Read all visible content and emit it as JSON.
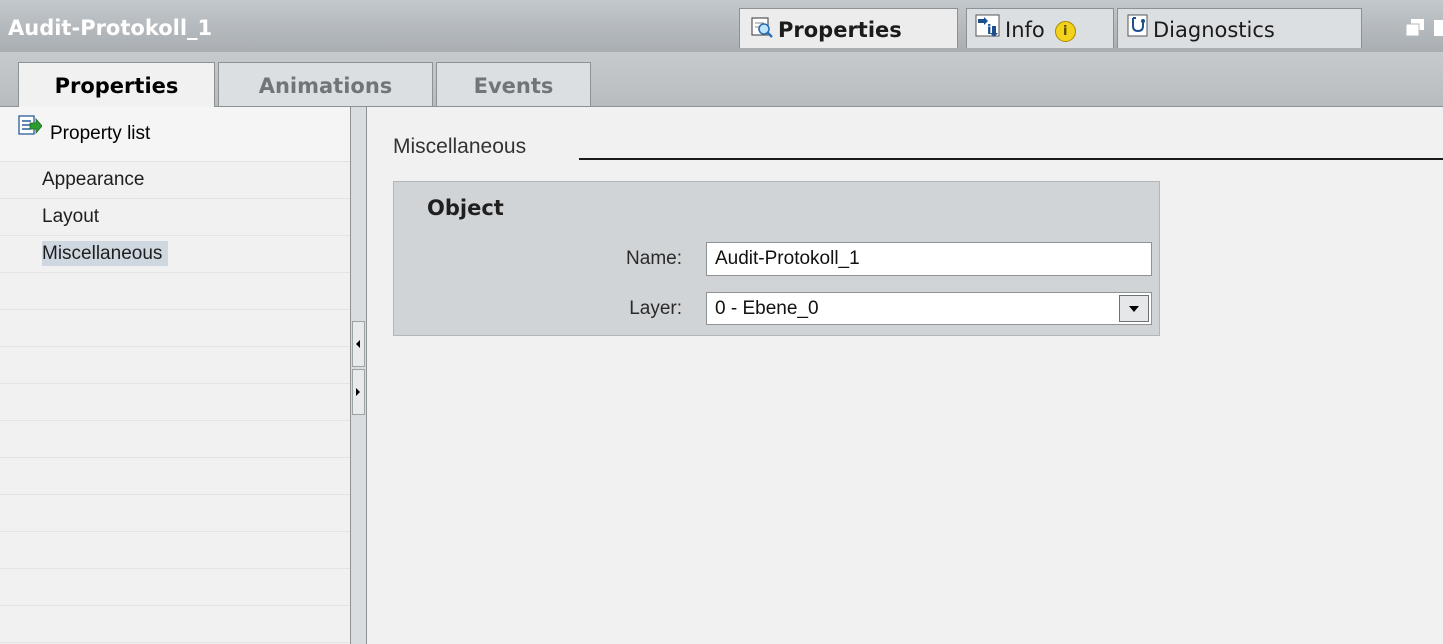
{
  "window": {
    "title": "Audit-Protokoll_1"
  },
  "inspector_tabs": [
    {
      "label": "Properties",
      "icon": "magnifier-properties-icon",
      "active": true
    },
    {
      "label": "Info",
      "icon": "info-arrow-icon",
      "badge_icon": "info-badge-icon"
    },
    {
      "label": "Diagnostics",
      "icon": "diagnostics-icon"
    }
  ],
  "tabs": [
    {
      "label": "Properties",
      "active": true
    },
    {
      "label": "Animations"
    },
    {
      "label": "Events"
    }
  ],
  "property_list": {
    "header": "Property list",
    "items": [
      "Appearance",
      "Layout",
      "Miscellaneous"
    ],
    "selected": "Miscellaneous"
  },
  "section": {
    "title": "Miscellaneous"
  },
  "object_group": {
    "title": "Object",
    "name_label": "Name:",
    "name_value": "Audit-Protokoll_1",
    "layer_label": "Layer:",
    "layer_value": "0 - Ebene_0"
  },
  "colors": {
    "accent_selected": "#cfd8e0",
    "title_text": "#ffffff"
  }
}
